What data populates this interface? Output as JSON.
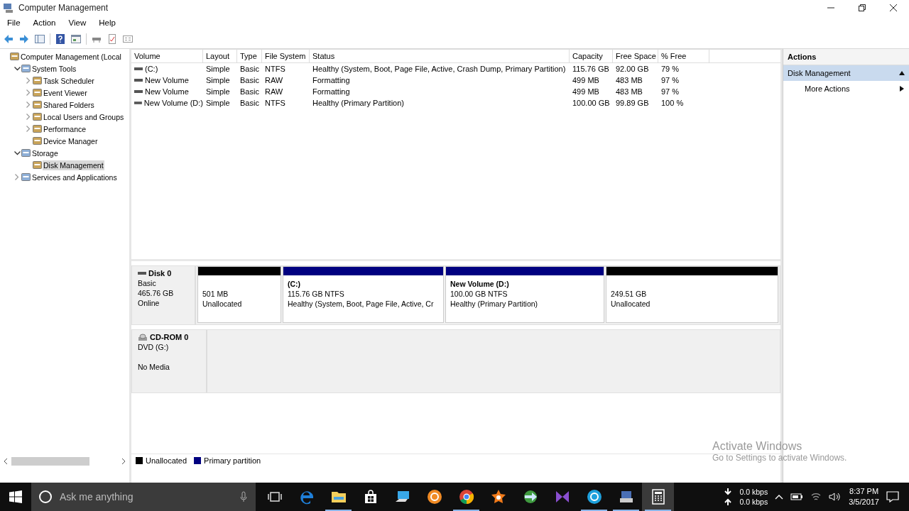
{
  "window": {
    "title": "Computer Management"
  },
  "menu": [
    "File",
    "Action",
    "View",
    "Help"
  ],
  "tree": [
    {
      "label": "Computer Management (Local",
      "selected": false,
      "children": [
        {
          "label": "System Tools",
          "kind": "folder",
          "expanded": true,
          "selected": false,
          "children": [
            {
              "label": "Task Scheduler",
              "kind": "folder",
              "expanded": false,
              "selected": false
            },
            {
              "label": "Event Viewer",
              "kind": "folder",
              "expanded": false,
              "selected": false
            },
            {
              "label": "Shared Folders",
              "kind": "folder",
              "expanded": false,
              "selected": false
            },
            {
              "label": "Local Users and Groups",
              "kind": "folder",
              "expanded": false,
              "selected": false
            },
            {
              "label": "Performance",
              "kind": "folder",
              "expanded": false,
              "selected": false
            },
            {
              "label": "Device Manager",
              "kind": "leaf",
              "selected": false
            }
          ]
        },
        {
          "label": "Storage",
          "kind": "folder",
          "expanded": true,
          "selected": false,
          "children": [
            {
              "label": "Disk Management",
              "kind": "leaf",
              "selected": true
            }
          ]
        },
        {
          "label": "Services and Applications",
          "kind": "folder",
          "expanded": false,
          "selected": false
        }
      ]
    }
  ],
  "table": {
    "columns": [
      "Volume",
      "Layout",
      "Type",
      "File System",
      "Status",
      "Capacity",
      "Free Space",
      "% Free"
    ],
    "rows": [
      [
        "(C:)",
        "Simple",
        "Basic",
        "NTFS",
        "Healthy (System, Boot, Page File, Active, Crash Dump, Primary Partition)",
        "115.76 GB",
        "92.00 GB",
        "79 %"
      ],
      [
        "New Volume",
        "Simple",
        "Basic",
        "RAW",
        "Formatting",
        "499 MB",
        "483 MB",
        "97 %"
      ],
      [
        "New Volume",
        "Simple",
        "Basic",
        "RAW",
        "Formatting",
        "499 MB",
        "483 MB",
        "97 %"
      ],
      [
        "New Volume (D:)",
        "Simple",
        "Basic",
        "NTFS",
        "Healthy (Primary Partition)",
        "100.00 GB",
        "99.89 GB",
        "100 %"
      ]
    ]
  },
  "disks": [
    {
      "kind": "disk",
      "name": "Disk 0",
      "lines": [
        "Basic",
        "465.76 GB",
        "Online"
      ],
      "partitions": [
        {
          "color": "#000000",
          "lines": [
            "501 MB",
            "Unallocated"
          ]
        },
        {
          "color": "#000080",
          "title": "(C:)",
          "lines": [
            "115.76 GB NTFS",
            "Healthy (System, Boot, Page File, Active, Cr"
          ]
        },
        {
          "color": "#000080",
          "title": "New Volume (D:)",
          "lines": [
            "100.00 GB NTFS",
            "Healthy (Primary Partition)"
          ]
        },
        {
          "color": "#000000",
          "lines": [
            "249.51 GB",
            "Unallocated"
          ]
        }
      ]
    },
    {
      "kind": "cdrom",
      "name": "CD-ROM 0",
      "lines": [
        "DVD (G:)",
        "No Media"
      ]
    }
  ],
  "legend": [
    {
      "label": "Unallocated",
      "color": "#000000"
    },
    {
      "label": "Primary partition",
      "color": "#000080"
    }
  ],
  "actions": {
    "title": "Actions",
    "items": [
      {
        "label": "Disk Management",
        "kind": "group",
        "selected": true
      },
      {
        "label": "More Actions",
        "kind": "submenu",
        "selected": false
      }
    ]
  },
  "activation": {
    "title": "Activate Windows",
    "subtitle": "Go to Settings to activate Windows."
  },
  "taskbar": {
    "search": {
      "placeholder": "Ask me anything"
    },
    "apps": [
      {
        "kind": "taskview",
        "running": false,
        "selected": false
      },
      {
        "kind": "edge",
        "running": false,
        "selected": false
      },
      {
        "kind": "explorer",
        "running": true,
        "selected": false
      },
      {
        "kind": "store",
        "running": false,
        "selected": false
      },
      {
        "kind": "remote",
        "running": false,
        "selected": false
      },
      {
        "kind": "orange",
        "running": false,
        "selected": false
      },
      {
        "kind": "chrome",
        "running": true,
        "selected": false
      },
      {
        "kind": "avast",
        "running": false,
        "selected": false
      },
      {
        "kind": "download",
        "running": false,
        "selected": false
      },
      {
        "kind": "studio",
        "running": false,
        "selected": false
      },
      {
        "kind": "skype",
        "running": true,
        "selected": false
      },
      {
        "kind": "manager",
        "running": true,
        "selected": false
      },
      {
        "kind": "calculator",
        "running": true,
        "selected": true
      }
    ],
    "net": [
      "0.0 kbps",
      "0.0 kbps"
    ],
    "time": "8:37 PM",
    "date": "3/5/2017"
  }
}
